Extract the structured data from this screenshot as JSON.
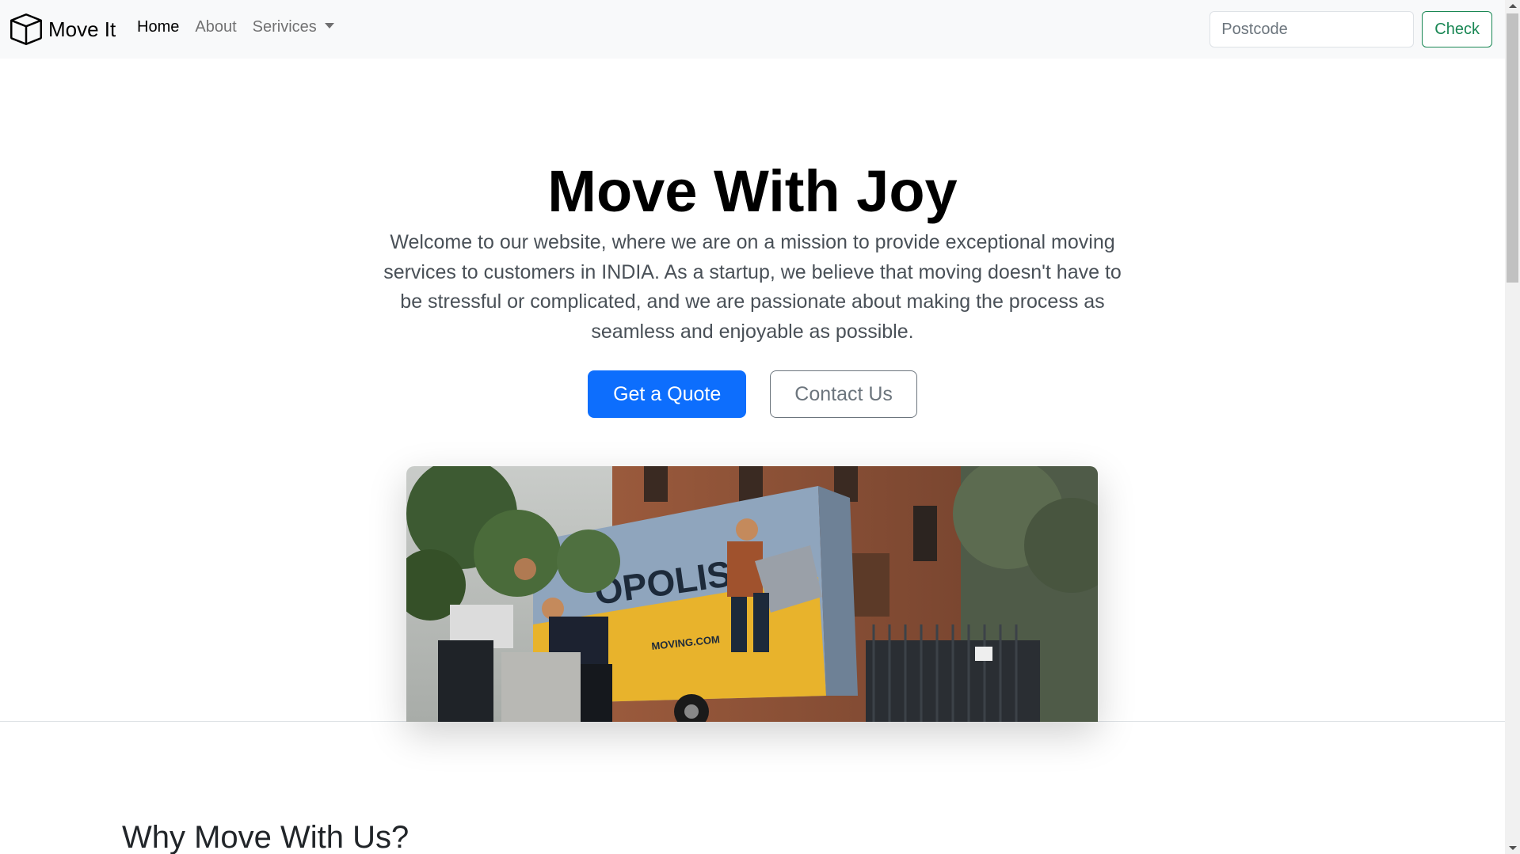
{
  "navbar": {
    "brand_name": "Move It",
    "links": [
      {
        "label": "Home",
        "active": true
      },
      {
        "label": "About",
        "active": false
      },
      {
        "label": "Serivices",
        "active": false,
        "dropdown": true
      }
    ],
    "postcode_placeholder": "Postcode",
    "check_label": "Check"
  },
  "hero": {
    "title": "Move With Joy",
    "lead": "Welcome to our website, where we are on a mission to provide exceptional moving services to customers in INDIA. As a startup, we believe that moving doesn't have to be stressful or complicated, and we are passionate about making the process as seamless and enjoyable as possible.",
    "primary_button": "Get a Quote",
    "secondary_button": "Contact Us",
    "image_truck_text": "OPOLIS",
    "image_truck_site": "MOVING.COM"
  },
  "features": {
    "title": "Why Move With Us?"
  },
  "colors": {
    "primary": "#0d6efd",
    "success": "#198754",
    "navbar_bg": "#f8f9fa",
    "secondary": "#6c757d"
  },
  "icons": {
    "brand": "box-icon",
    "dropdown": "caret-down-icon"
  }
}
